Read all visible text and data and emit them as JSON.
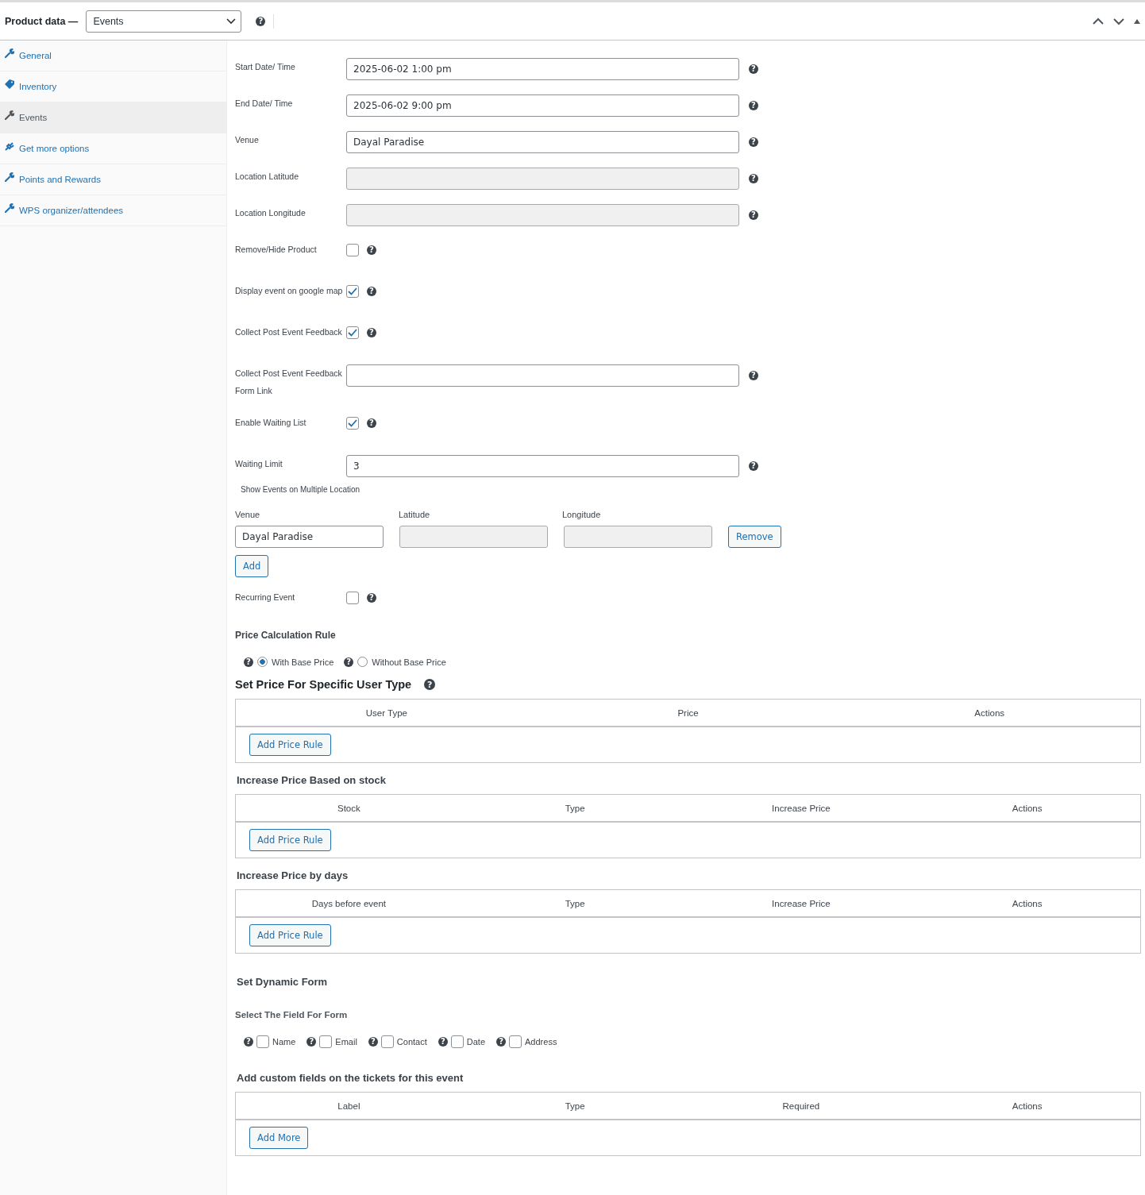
{
  "header": {
    "title": "Product data —",
    "product_type": "Events",
    "help": "?"
  },
  "tabs": [
    {
      "label": "General",
      "kind": "wrench",
      "selected": false
    },
    {
      "label": "Inventory",
      "kind": "tag",
      "selected": false
    },
    {
      "label": "Events",
      "kind": "wrench",
      "selected": true
    },
    {
      "label": "Get more options",
      "kind": "plug",
      "selected": false
    },
    {
      "label": "Points and Rewards",
      "kind": "wrench",
      "selected": false
    },
    {
      "label": "WPS organizer/attendees",
      "kind": "wrench",
      "selected": false
    }
  ],
  "fields": [
    {
      "kind": "text",
      "label": "Start Date/ Time",
      "value": "2025-06-02 1:00 pm",
      "disabled": false,
      "help": "?"
    },
    {
      "kind": "text",
      "label": "End Date/ Time",
      "value": "2025-06-02 9:00 pm",
      "disabled": false,
      "help": "?"
    },
    {
      "kind": "text",
      "label": "Venue",
      "value": "Dayal Paradise",
      "disabled": false,
      "help": "?"
    },
    {
      "kind": "text",
      "label": "Location Latitude",
      "disabled": true,
      "help": "?"
    },
    {
      "kind": "text",
      "label": "Location Longitude",
      "disabled": true,
      "help": "?"
    },
    {
      "kind": "checkbox",
      "label": "Remove/Hide Product",
      "checked": false,
      "help": "?"
    },
    {
      "kind": "checkbox",
      "label": "Display event on google map",
      "checked": true,
      "help": "?"
    },
    {
      "kind": "checkbox",
      "label": "Collect Post Event Feedback",
      "checked": true,
      "help": "?"
    },
    {
      "kind": "text",
      "label": "Collect Post Event Feedback Form Link",
      "disabled": false,
      "help": "?"
    },
    {
      "kind": "checkbox",
      "label": "Enable Waiting List",
      "checked": true,
      "help": "?"
    },
    {
      "kind": "text",
      "label": "Waiting Limit",
      "value": "3",
      "disabled": false,
      "help": "?"
    }
  ],
  "multi_location": {
    "title": "Show Events on Multiple Location",
    "columns": [
      "Venue",
      "Latitude",
      "Longitude"
    ],
    "rows": [
      {
        "venue": "Dayal Paradise",
        "remove_button": "Remove"
      }
    ],
    "add_button": "Add"
  },
  "recurring": {
    "label": "Recurring Event",
    "checked": false,
    "help": "?"
  },
  "price_calculation": {
    "heading": "Price Calculation Rule",
    "options": [
      {
        "label": "With Base Price",
        "selected": true,
        "help": "?"
      },
      {
        "label": "Without Base Price",
        "selected": false,
        "help": "?"
      }
    ]
  },
  "tables_before_form": [
    {
      "heading": "Set Price For Specific User Type",
      "large": true,
      "help": "?",
      "columns": [
        "User Type",
        "Price",
        "Actions"
      ],
      "button": "Add Price Rule"
    },
    {
      "heading": "Increase Price Based on stock",
      "large": false,
      "columns": [
        "Stock",
        "Type",
        "Increase Price",
        "Actions"
      ],
      "button": "Add Price Rule"
    },
    {
      "heading": "Increase Price by days",
      "large": false,
      "columns": [
        "Days before event",
        "Type",
        "Increase Price",
        "Actions"
      ],
      "button": "Add Price Rule"
    }
  ],
  "dynamic_form": {
    "heading": "Set Dynamic Form",
    "subheading": "Select The Field For Form",
    "options": [
      {
        "label": "Name",
        "checked": false,
        "help": "?"
      },
      {
        "label": "Email",
        "checked": false,
        "help": "?"
      },
      {
        "label": "Contact",
        "checked": false,
        "help": "?"
      },
      {
        "label": "Date",
        "checked": false,
        "help": "?"
      },
      {
        "label": "Address",
        "checked": false,
        "help": "?"
      }
    ]
  },
  "custom_fields": {
    "heading": "Add custom fields on the tickets for this event",
    "columns": [
      "Label",
      "Type",
      "Required",
      "Actions"
    ],
    "button": "Add More"
  }
}
